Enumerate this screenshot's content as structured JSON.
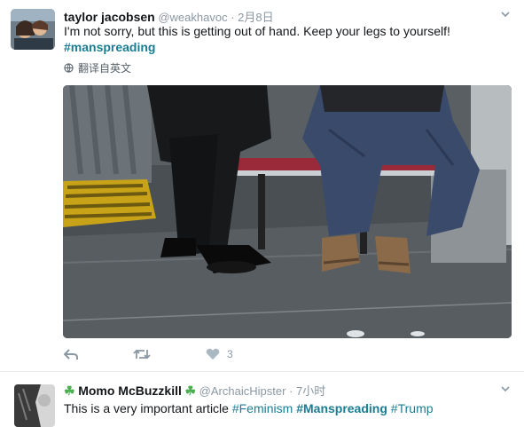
{
  "tweet1": {
    "name": "taylor jacobsen",
    "handle": "@weakhavoc",
    "dot": "·",
    "time": "2月8日",
    "text": "I'm not sorry, but this is getting out of hand. Keep your legs to yourself!",
    "hashtag": "#manspreading",
    "translate": "翻译自英文",
    "like_count": "3"
  },
  "tweet2": {
    "clover_left": "☘",
    "name": "Momo McBuzzkill",
    "clover_right": "☘",
    "handle": "@ArchaicHipster",
    "dot": "·",
    "time": "7小时",
    "text_prefix": "This is a very important article ",
    "hashtags": [
      "#Feminism",
      "#Manspreading",
      "#Trump"
    ]
  },
  "icons": {
    "reply": "reply-icon",
    "retweet": "retweet-icon",
    "like": "heart-icon",
    "globe": "globe-icon",
    "caret": "chevron-down-icon"
  },
  "colors": {
    "hashtag": "#1b7c93",
    "muted": "#8b98a3",
    "text": "#14171a"
  }
}
